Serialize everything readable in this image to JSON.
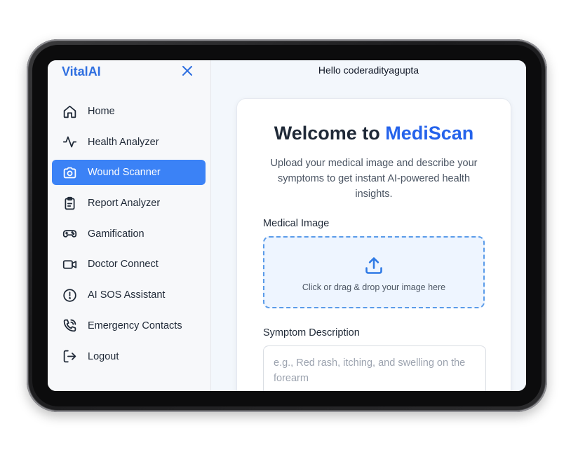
{
  "sidebar": {
    "brand": "VitalAI",
    "items": [
      {
        "label": "Home",
        "icon": "home-icon"
      },
      {
        "label": "Health Analyzer",
        "icon": "activity-icon"
      },
      {
        "label": "Wound Scanner",
        "icon": "camera-icon",
        "active": true
      },
      {
        "label": "Report Analyzer",
        "icon": "clipboard-icon"
      },
      {
        "label": "Gamification",
        "icon": "gamepad-icon"
      },
      {
        "label": "Doctor Connect",
        "icon": "video-icon"
      },
      {
        "label": "AI SOS Assistant",
        "icon": "alert-circle-icon"
      },
      {
        "label": "Emergency Contacts",
        "icon": "phone-call-icon"
      },
      {
        "label": "Logout",
        "icon": "logout-icon"
      }
    ]
  },
  "header": {
    "greeting": "Hello coderadityagupta"
  },
  "main": {
    "title_prefix": "Welcome to ",
    "title_accent": "MediScan",
    "subtitle": "Upload your medical image and describe your symptoms to get instant AI-powered health insights.",
    "image_label": "Medical Image",
    "dropzone_text": "Click or drag & drop your image here",
    "symptom_label": "Symptom Description",
    "symptom_placeholder": "e.g., Red rash, itching, and swelling on the forearm"
  },
  "colors": {
    "brand": "#2f6fe0",
    "active_nav": "#3b82f6",
    "accent": "#2563eb",
    "dropzone_border": "#5a9be9"
  }
}
